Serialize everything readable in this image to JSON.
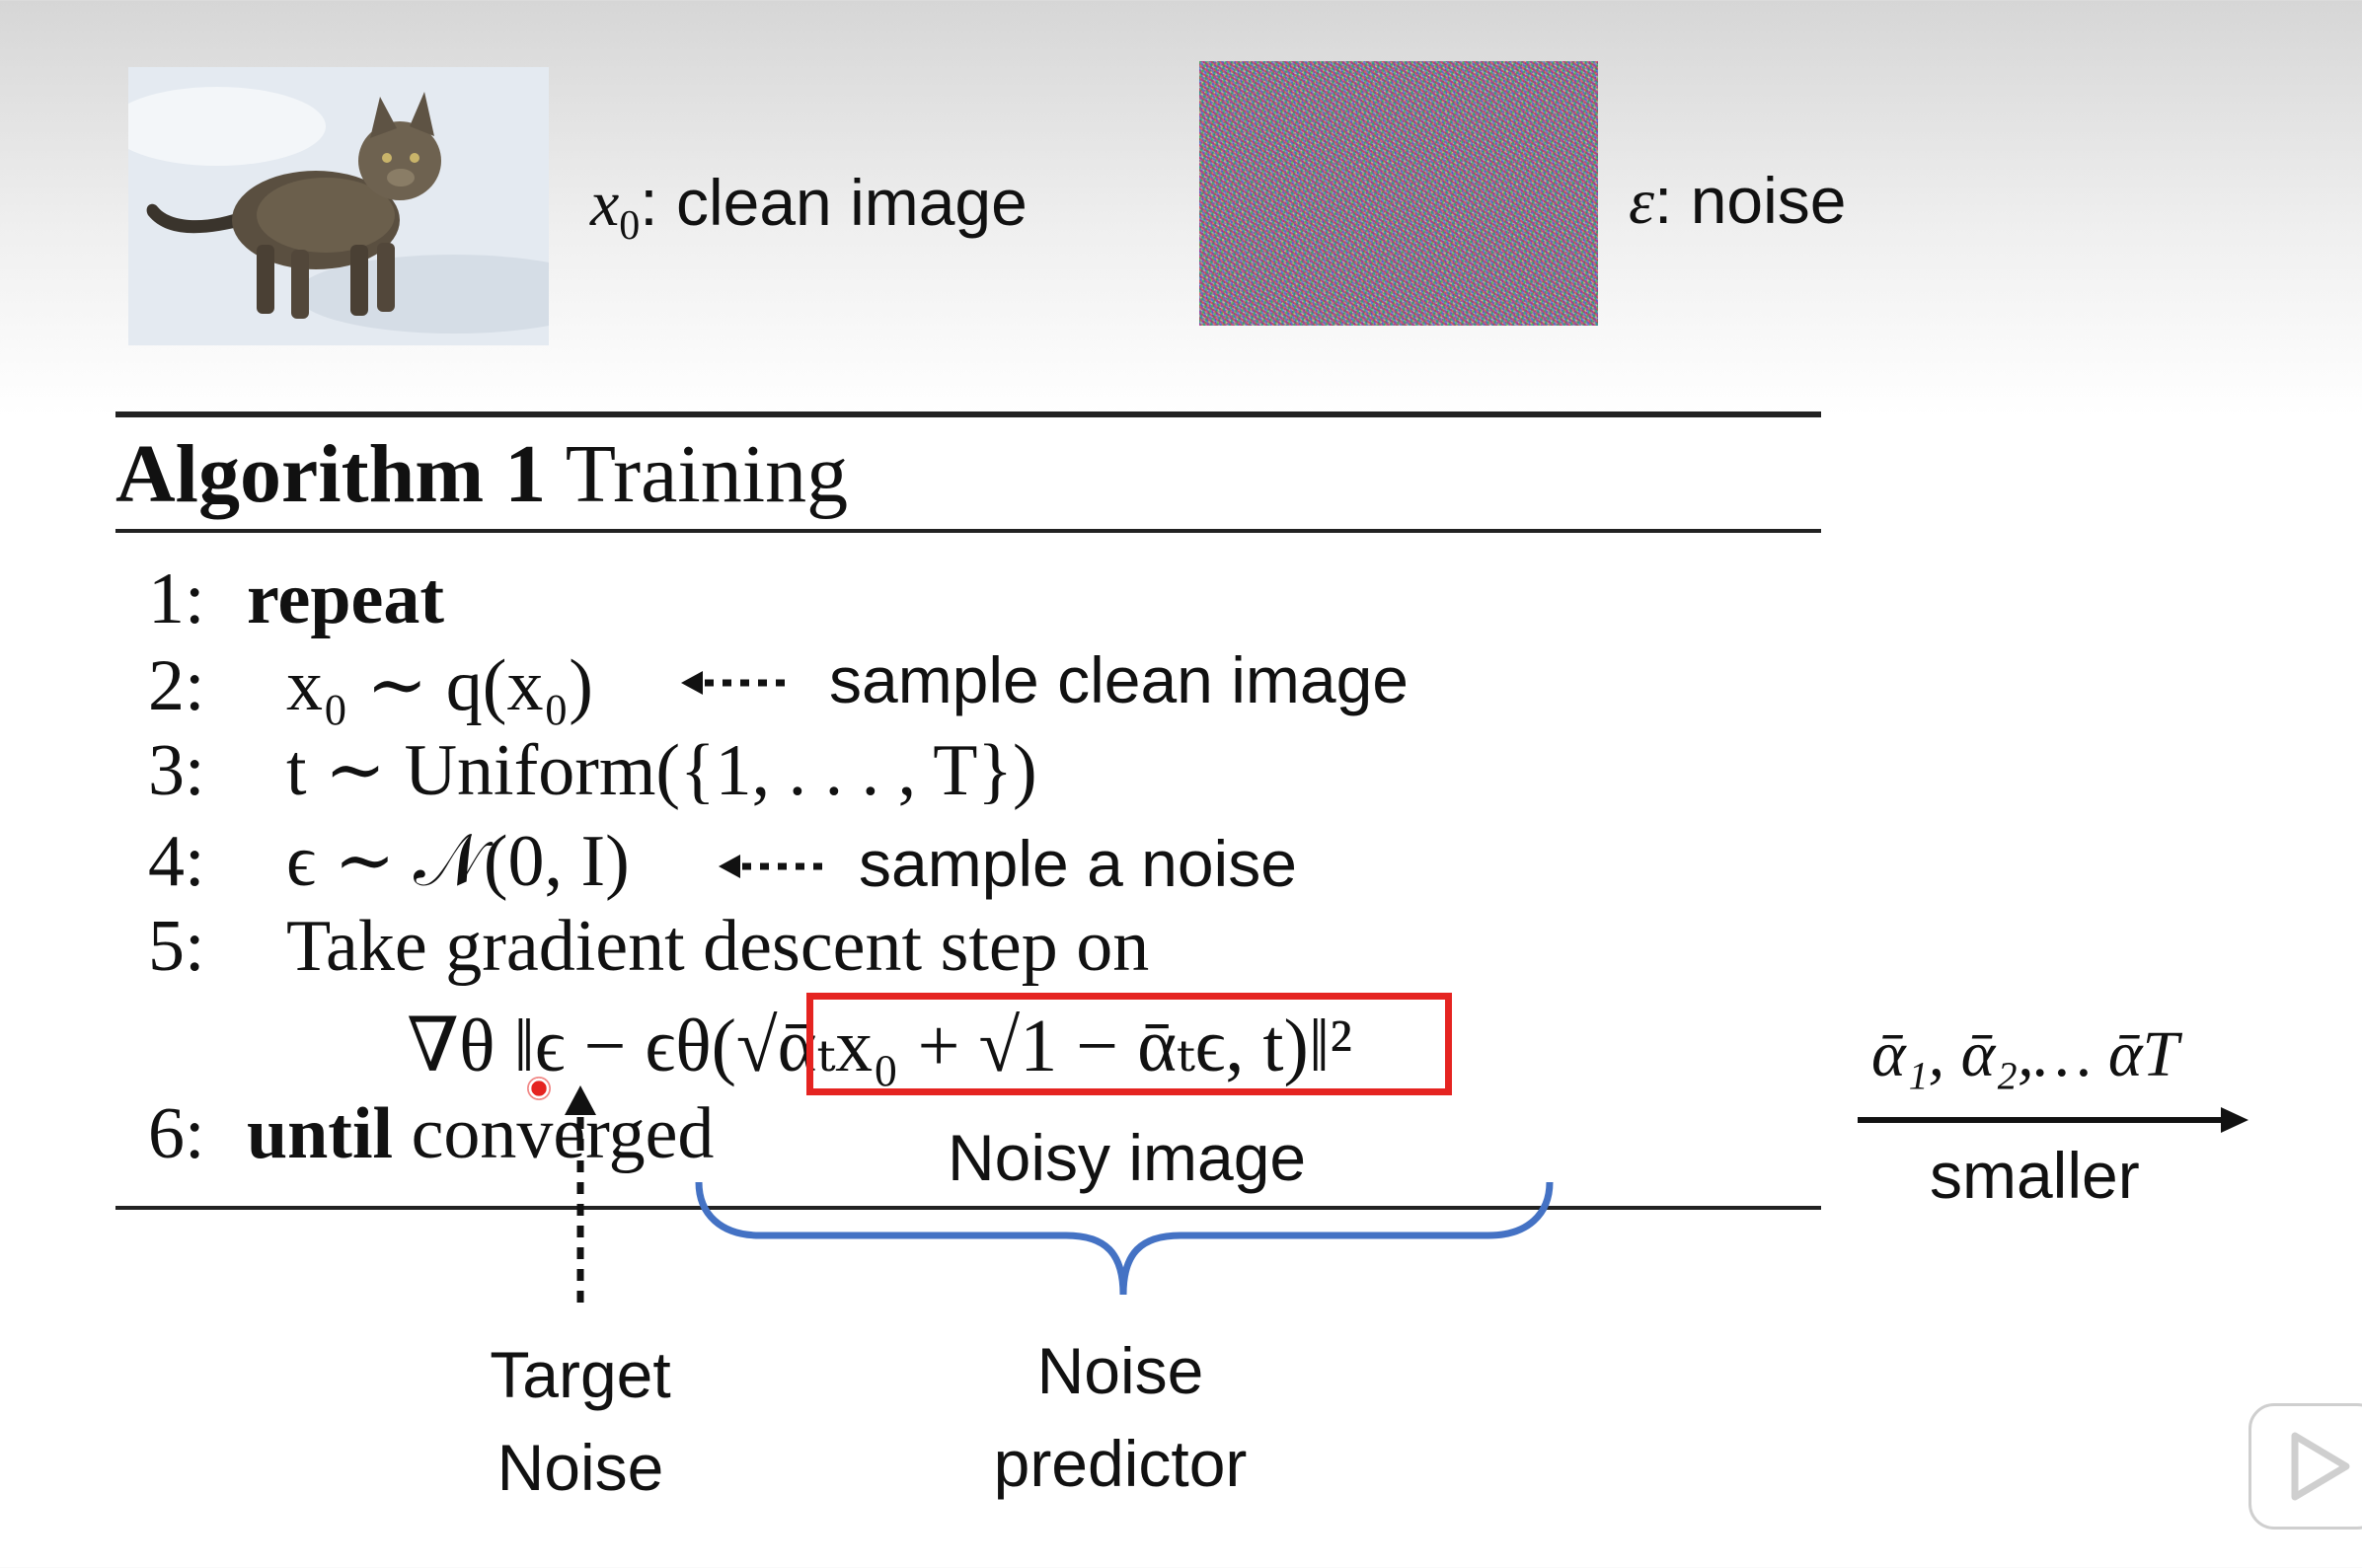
{
  "top": {
    "clean_var": "x",
    "clean_sub": "0",
    "clean_label": ": clean image",
    "noise_var": "ε",
    "noise_label": ": noise"
  },
  "algorithm": {
    "title_bold": "Algorithm 1",
    "title_rest": "Training",
    "lines": [
      {
        "num": "1:",
        "keyword": "repeat"
      },
      {
        "num": "2:",
        "formula": "x₀ ∼ q(x₀)"
      },
      {
        "num": "3:",
        "formula": "t ∼ Uniform({1, . . . , T})"
      },
      {
        "num": "4:",
        "formula": "ϵ ∼ 𝒩(0, I)"
      },
      {
        "num": "5:",
        "text": "Take gradient descent step on"
      },
      {
        "formula": "∇θ ‖ϵ − ϵθ(√ᾱₜx₀ + √1 − ᾱₜϵ, t)‖²"
      },
      {
        "num": "6:",
        "keyword": "until",
        "text": "converged"
      }
    ]
  },
  "annotations": {
    "sample_clean": "sample clean image",
    "sample_noise": "sample a noise",
    "noisy_image": "Noisy image",
    "target_line1": "Target",
    "target_line2": "Noise",
    "predictor_line1": "Noise",
    "predictor_line2": "predictor",
    "alpha_seq": "ᾱ₁, ᾱ₂,… ᾱT",
    "smaller": "smaller"
  },
  "colors": {
    "highlight_box": "#e52421",
    "brace": "#4472c4",
    "text": "#111111"
  },
  "icons": [
    "play-icon"
  ]
}
